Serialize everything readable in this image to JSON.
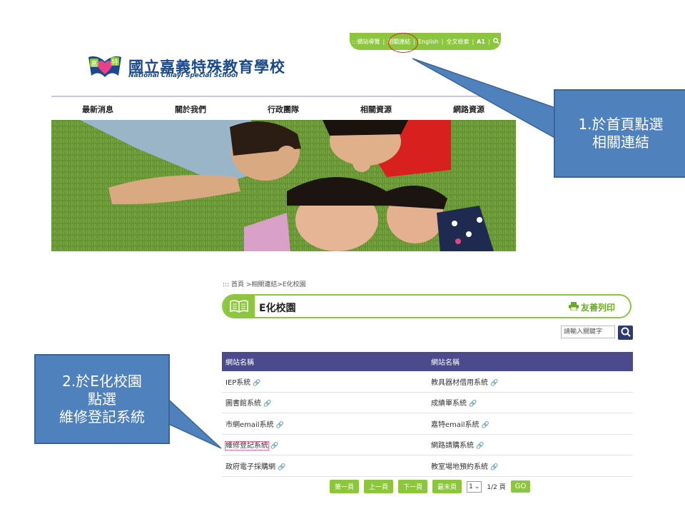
{
  "topbar": {
    "sitemap": ":::網站導覽",
    "links": "相關連結",
    "english": "English",
    "fulltext": "全文檢索",
    "font": "A1",
    "sep": "|"
  },
  "logo": {
    "zh": "國立嘉義特殊教育學校",
    "en": "National Chiayi Special School",
    "char1": "嘉",
    "char2": "特"
  },
  "nav": [
    "最新消息",
    "關於我們",
    "行政團隊",
    "相關資源",
    "網路資源"
  ],
  "callout1": {
    "line1": "1.於首頁點選",
    "line2": "相關連結"
  },
  "callout2": {
    "line1": "2.於E化校園",
    "line2": "點選",
    "line3": "維修登記系統"
  },
  "breadcrumb": "::: 首頁 >相關連結>E化校園",
  "page_title": "E化校園",
  "print_label": "友善列印",
  "search": {
    "placeholder": "請輸入關鍵字"
  },
  "table": {
    "headers": [
      "網站名稱",
      "網站名稱"
    ],
    "rows": [
      [
        "IEP系統",
        "教具器材借用系統"
      ],
      [
        "圖書館系統",
        "成績單系統"
      ],
      [
        "市網email系統",
        "嘉特email系統"
      ],
      [
        "維修登記系統",
        "網路請購系統"
      ],
      [
        "政府電子採購網",
        "教室場地預約系統"
      ]
    ]
  },
  "pager": {
    "first": "第一頁",
    "prev": "上一頁",
    "next": "下一頁",
    "last": "最末頁",
    "page_select": "1",
    "total": "1/2 頁",
    "go": "GO"
  },
  "colors": {
    "accent_green": "#8cc63f",
    "header_navy": "#4a4a8c",
    "callout_blue": "#4f81bd"
  }
}
